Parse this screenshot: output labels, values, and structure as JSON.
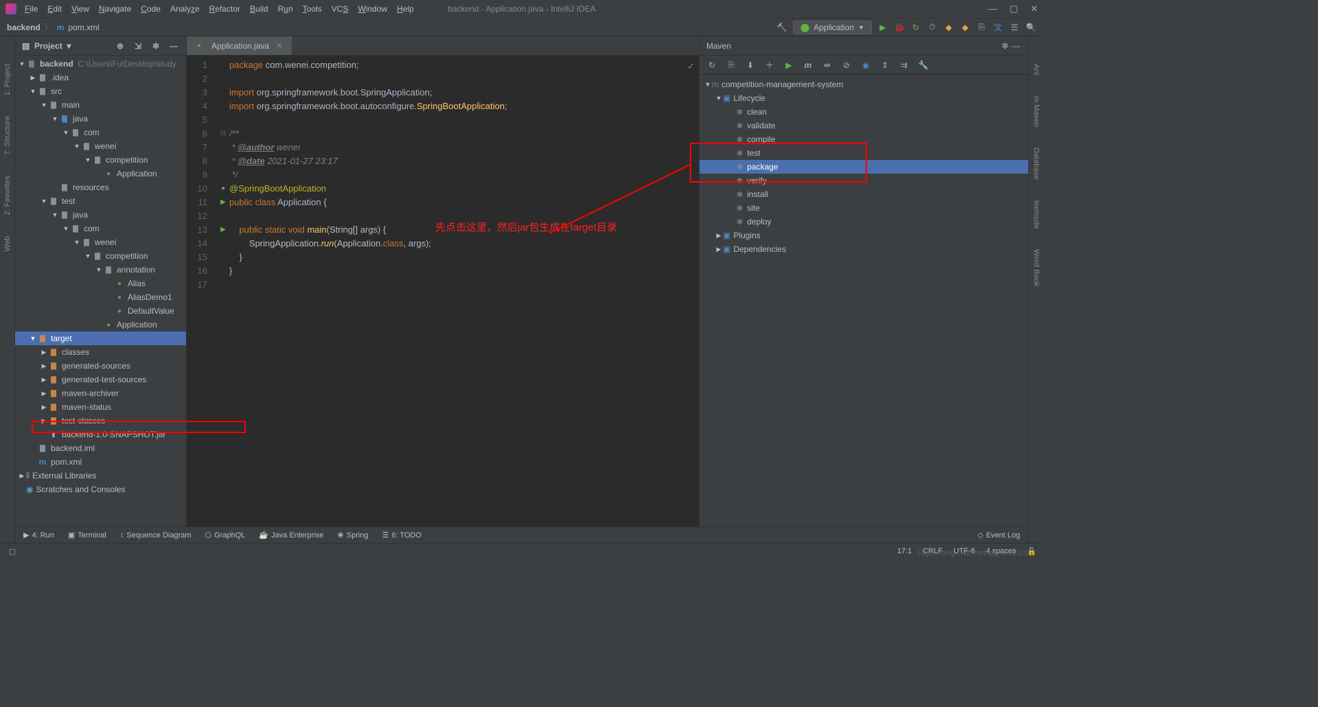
{
  "window_title": "backend - Application.java - IntelliJ IDEA",
  "menu": [
    "File",
    "Edit",
    "View",
    "Navigate",
    "Code",
    "Analyze",
    "Refactor",
    "Build",
    "Run",
    "Tools",
    "VCS",
    "Window",
    "Help"
  ],
  "breadcrumb": {
    "root": "backend",
    "file": "pom.xml"
  },
  "run_config": "Application",
  "project_panel": {
    "title": "Project"
  },
  "project_tree": {
    "root": "backend",
    "root_path": "C:\\Users\\Fu\\Desktop\\study",
    "idea": ".idea",
    "src": "src",
    "main": "main",
    "test": "test",
    "java": "java",
    "com": "com",
    "wenei": "wenei",
    "competition": "competition",
    "annotation": "annotation",
    "alias": "Alias",
    "aliasdemo": "AliasDemo1",
    "defaultvalue": "DefaultValue",
    "application": "Application",
    "resources": "resources",
    "target": "target",
    "classes": "classes",
    "gen_sources": "generated-sources",
    "gen_test_sources": "generated-test-sources",
    "maven_archiver": "maven-archiver",
    "maven_status": "maven-status",
    "test_classes": "test-classes",
    "jar": "backend-1.0-SNAPSHOT.jar",
    "iml": "backend.iml",
    "pom": "pom.xml",
    "ext_lib": "External Libraries",
    "scratches": "Scratches and Consoles"
  },
  "editor": {
    "tab": "Application.java",
    "lines": {
      "l1": "package com.wenei.competition;",
      "l3": "import org.springframework.boot.SpringApplication;",
      "l4_pre": "import org.springframework.boot.autoconfigure.",
      "l4_cls": "SpringBootApplication",
      "l6": "/**",
      "l7": " * @author wenei",
      "l7_tag": "@author",
      "l7_val": " wenei",
      "l8_tag": "@date",
      "l8_val": " 2021-01-27 23:17",
      "l9": " */",
      "l10": "@SpringBootApplication",
      "l11_pub": "public class ",
      "l11_cls": "Application",
      "l13_pre": "public static void ",
      "l13_main": "main",
      "l13_args": "(String[] args)",
      "l14_pre": "SpringApplication.",
      "l14_run": "run",
      "l14_args1": "(Application.",
      "l14_class": "class",
      "l14_args2": ", args);"
    },
    "line_numbers": [
      "1",
      "2",
      "3",
      "4",
      "5",
      "6",
      "7",
      "8",
      "9",
      "10",
      "11",
      "12",
      "13",
      "14",
      "15",
      "16",
      "17"
    ]
  },
  "maven": {
    "title": "Maven",
    "project": "competition-management-system",
    "lifecycle": "Lifecycle",
    "goals": [
      "clean",
      "validate",
      "compile",
      "test",
      "package",
      "verify",
      "install",
      "site",
      "deploy"
    ],
    "selected": "package",
    "plugins": "Plugins",
    "dependencies": "Dependencies"
  },
  "bottom_tools": {
    "run": "4: Run",
    "terminal": "Terminal",
    "seq": "Sequence Diagram",
    "graphql": "GraphQL",
    "java_ent": "Java Enterprise",
    "spring": "Spring",
    "todo": "6: TODO",
    "event_log": "Event Log"
  },
  "statusbar": {
    "pos": "17:1",
    "crlf": "CRLF",
    "encoding": "UTF-8",
    "indent": "4 spaces"
  },
  "left_rail": [
    "1: Project",
    "7: Structure",
    "2: Favorites",
    "Web"
  ],
  "right_rail": [
    "Ant",
    "m Maven",
    "Database",
    "leetcode",
    "Word Book"
  ],
  "annotation_text": "先点击这里，然后jar包生成在target目录",
  "watermark": "https://blog.csdn.net/qq_43621091"
}
